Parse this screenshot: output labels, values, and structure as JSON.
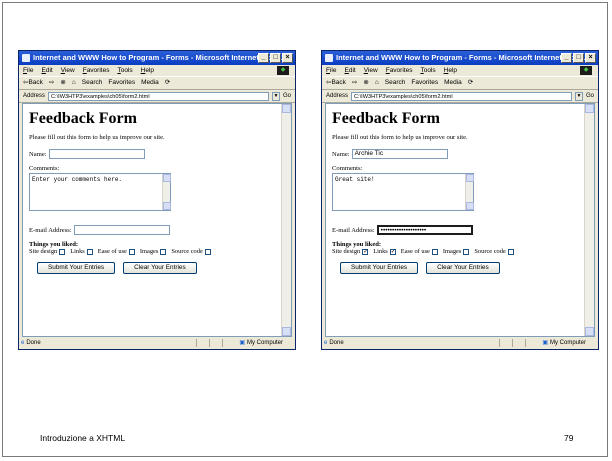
{
  "windows": [
    {
      "title": "Internet and WWW How to Program - Forms - Microsoft Internet Expl...",
      "menus": [
        "File",
        "Edit",
        "View",
        "Favorites",
        "Tools",
        "Help"
      ],
      "toolbar": [
        "⇦Back",
        "⇨",
        "⊗",
        "⌂",
        "Search",
        "Favorites",
        "Media",
        "⟳"
      ],
      "address_label": "Address",
      "address": "C:\\IW3HTP3\\examples\\ch05\\form2.html",
      "go": "Go",
      "form": {
        "heading": "Feedback Form",
        "intro": "Please fill out this form to help us improve our site.",
        "name_label": "Name:",
        "name_value": "",
        "comments_label": "Comments:",
        "comments_value": "Enter your comments here.",
        "email_label": "E-mail Address:",
        "email_value": "",
        "things_liked": "Things you liked:",
        "checkboxes": [
          {
            "label": "Site design",
            "checked": false
          },
          {
            "label": "Links",
            "checked": false
          },
          {
            "label": "Ease of use",
            "checked": false
          },
          {
            "label": "Images",
            "checked": false
          },
          {
            "label": "Source code",
            "checked": false
          }
        ],
        "submit": "Submit Your Entries",
        "clear": "Clear Your Entries"
      },
      "status": "Done",
      "zone": "My Computer"
    },
    {
      "title": "Internet and WWW How to Program - Forms - Microsoft Internet Expl...",
      "menus": [
        "File",
        "Edit",
        "View",
        "Favorites",
        "Tools",
        "Help"
      ],
      "toolbar": [
        "⇦Back",
        "⇨",
        "⊗",
        "⌂",
        "Search",
        "Favorites",
        "Media",
        "⟳"
      ],
      "address_label": "Address",
      "address": "C:\\IW3HTP3\\examples\\ch05\\form2.html",
      "go": "Go",
      "form": {
        "heading": "Feedback Form",
        "intro": "Please fill out this form to help us improve our site.",
        "name_label": "Name:",
        "name_value": "Archie Tic",
        "comments_label": "Comments:",
        "comments_value": "Great site!",
        "email_label": "E-mail Address:",
        "email_value": "••••••••••••••••••••",
        "things_liked": "Things you liked:",
        "checkboxes": [
          {
            "label": "Site design",
            "checked": true
          },
          {
            "label": "Links",
            "checked": true
          },
          {
            "label": "Ease of use",
            "checked": false
          },
          {
            "label": "Images",
            "checked": false
          },
          {
            "label": "Source code",
            "checked": false
          }
        ],
        "submit": "Submit Your Entries",
        "clear": "Clear Your Entries"
      },
      "status": "Done",
      "zone": "My Computer"
    }
  ],
  "footer": {
    "left": "Introduzione a XHTML",
    "page_number": "79"
  }
}
